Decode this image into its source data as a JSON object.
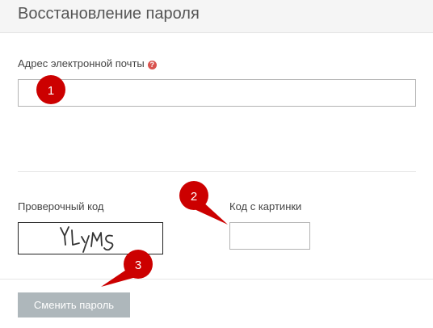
{
  "header": {
    "title": "Восстановление пароля"
  },
  "form": {
    "email_label": "Адрес электронной почты",
    "email_help_icon": "question-circle-icon",
    "email_value": "",
    "captcha_label": "Проверочный код",
    "captcha_text": "YLyMS",
    "code_label": "Код с картинки",
    "code_value": "",
    "submit_label": "Сменить пароль"
  },
  "annotations": {
    "color": "#cc0000",
    "markers": [
      "1",
      "2",
      "3"
    ]
  }
}
